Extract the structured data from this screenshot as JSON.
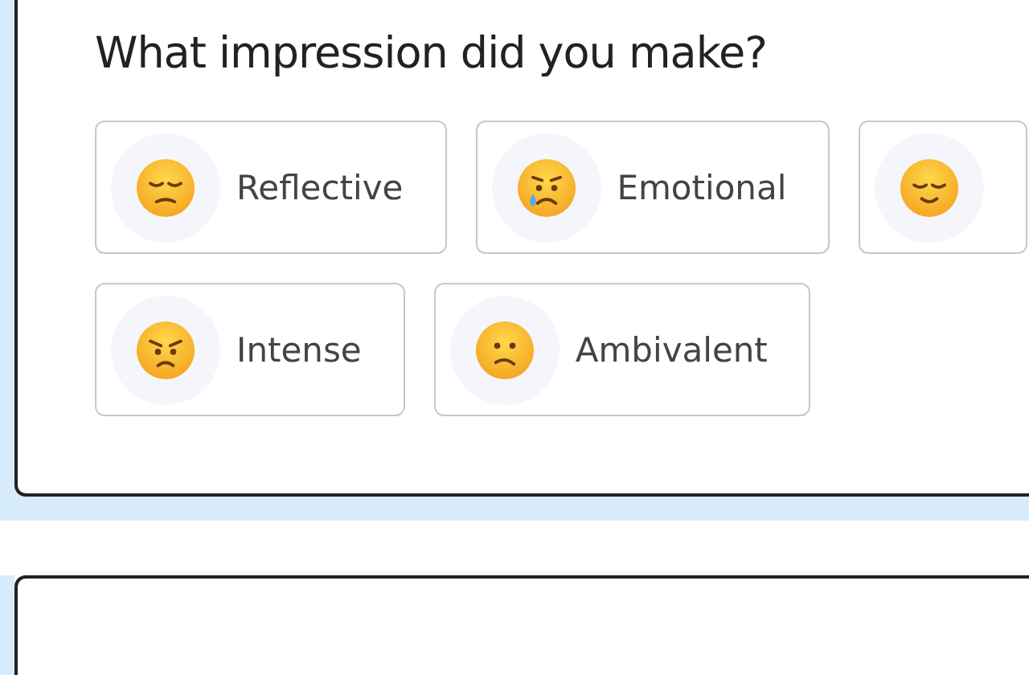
{
  "question": "What impression did you make?",
  "rows": [
    [
      {
        "kind": "pensive",
        "label": "Reflective"
      },
      {
        "kind": "crying",
        "label": "Emotional"
      },
      {
        "kind": "relieved"
      }
    ],
    [
      {
        "kind": "angry",
        "label": "Intense"
      },
      {
        "kind": "confused",
        "label": "Ambivalent"
      }
    ]
  ]
}
